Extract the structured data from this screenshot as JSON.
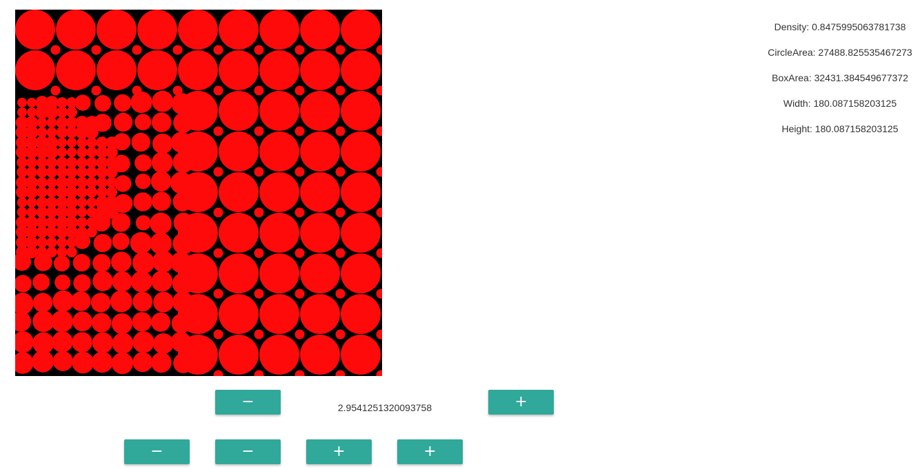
{
  "stats": {
    "density": "Density: 0.8475995063781738",
    "circle_area": "CircleArea: 27488.825535467273",
    "box_area": "BoxArea: 32431.384549677372",
    "width": "Width: 180.087158203125",
    "height": "Height: 180.087158203125"
  },
  "controls": {
    "scale_value": "2.9541251320093758",
    "scale_decrease_label": "−",
    "scale_increase_label": "+",
    "bottom_buttons": [
      "−",
      "−",
      "+",
      "+"
    ]
  },
  "colors": {
    "circle_fill": "#ff0a0a",
    "canvas_background": "#000000",
    "button": "#30a89a"
  },
  "icons": {
    "minus": "minus-icon",
    "plus": "plus-icon"
  }
}
